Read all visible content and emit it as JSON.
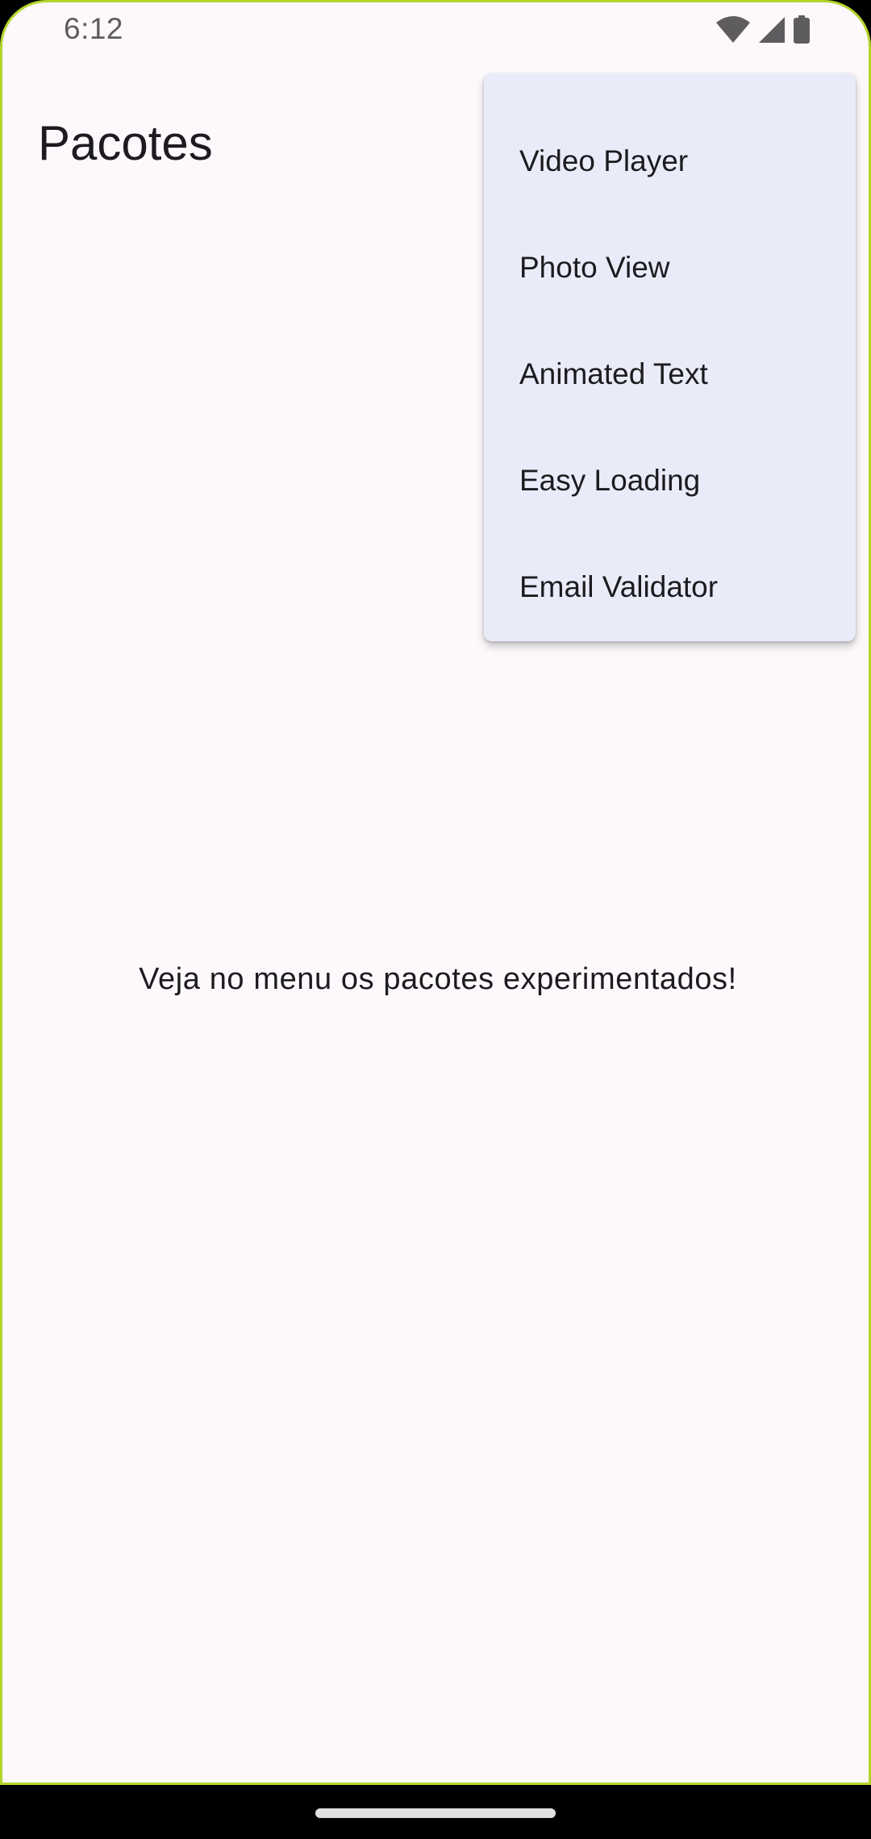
{
  "status_bar": {
    "time": "6:12",
    "icons": [
      "wifi-icon",
      "cellular-signal-icon",
      "battery-icon"
    ]
  },
  "app_bar": {
    "title": "Pacotes"
  },
  "body": {
    "message": "Veja no menu os pacotes experimentados!"
  },
  "menu": {
    "items": [
      {
        "label": "Video Player"
      },
      {
        "label": "Photo View"
      },
      {
        "label": "Animated Text"
      },
      {
        "label": "Easy Loading"
      },
      {
        "label": "Email Validator"
      }
    ]
  },
  "colors": {
    "background": "#fcf8fb",
    "menu_background": "#e9ecf8",
    "device_frame": "#b2d42c",
    "text_primary": "#1d1b1f"
  }
}
